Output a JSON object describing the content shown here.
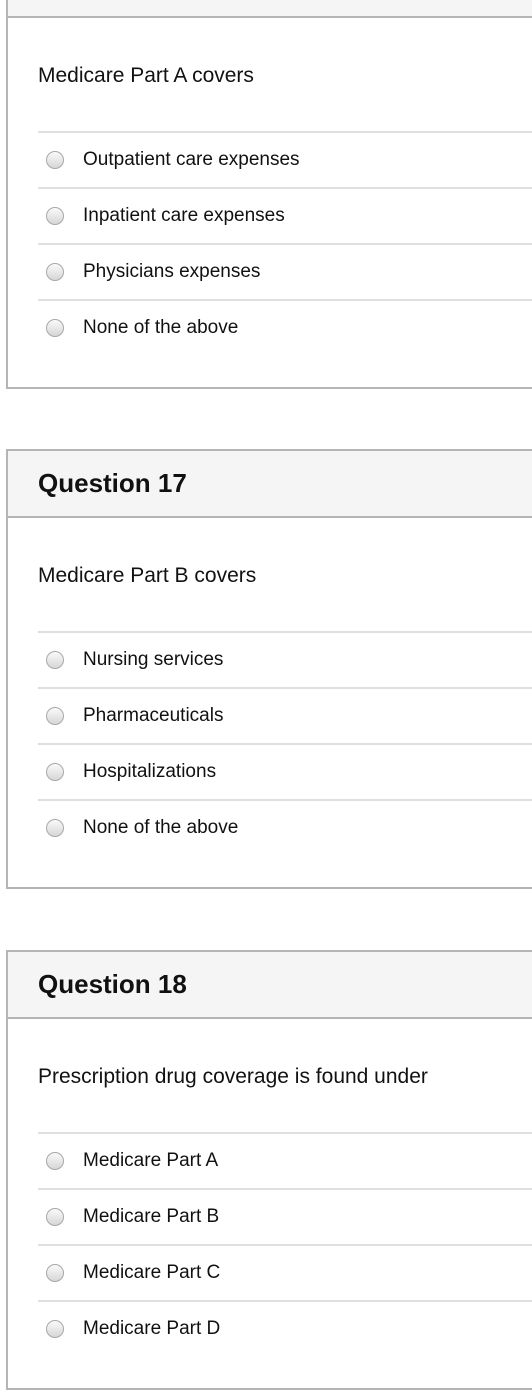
{
  "questions": [
    {
      "title": "",
      "text": "Medicare Part A covers",
      "options": [
        "Outpatient care expenses",
        "Inpatient care expenses",
        "Physicians expenses",
        "None of the above"
      ]
    },
    {
      "title": "Question 17",
      "text": "Medicare Part B covers",
      "options": [
        "Nursing services",
        "Pharmaceuticals",
        "Hospitalizations",
        "None of the above"
      ]
    },
    {
      "title": "Question 18",
      "text": "Prescription drug coverage is found under",
      "options": [
        "Medicare Part A",
        "Medicare Part B",
        "Medicare Part C",
        "Medicare Part D"
      ]
    }
  ]
}
